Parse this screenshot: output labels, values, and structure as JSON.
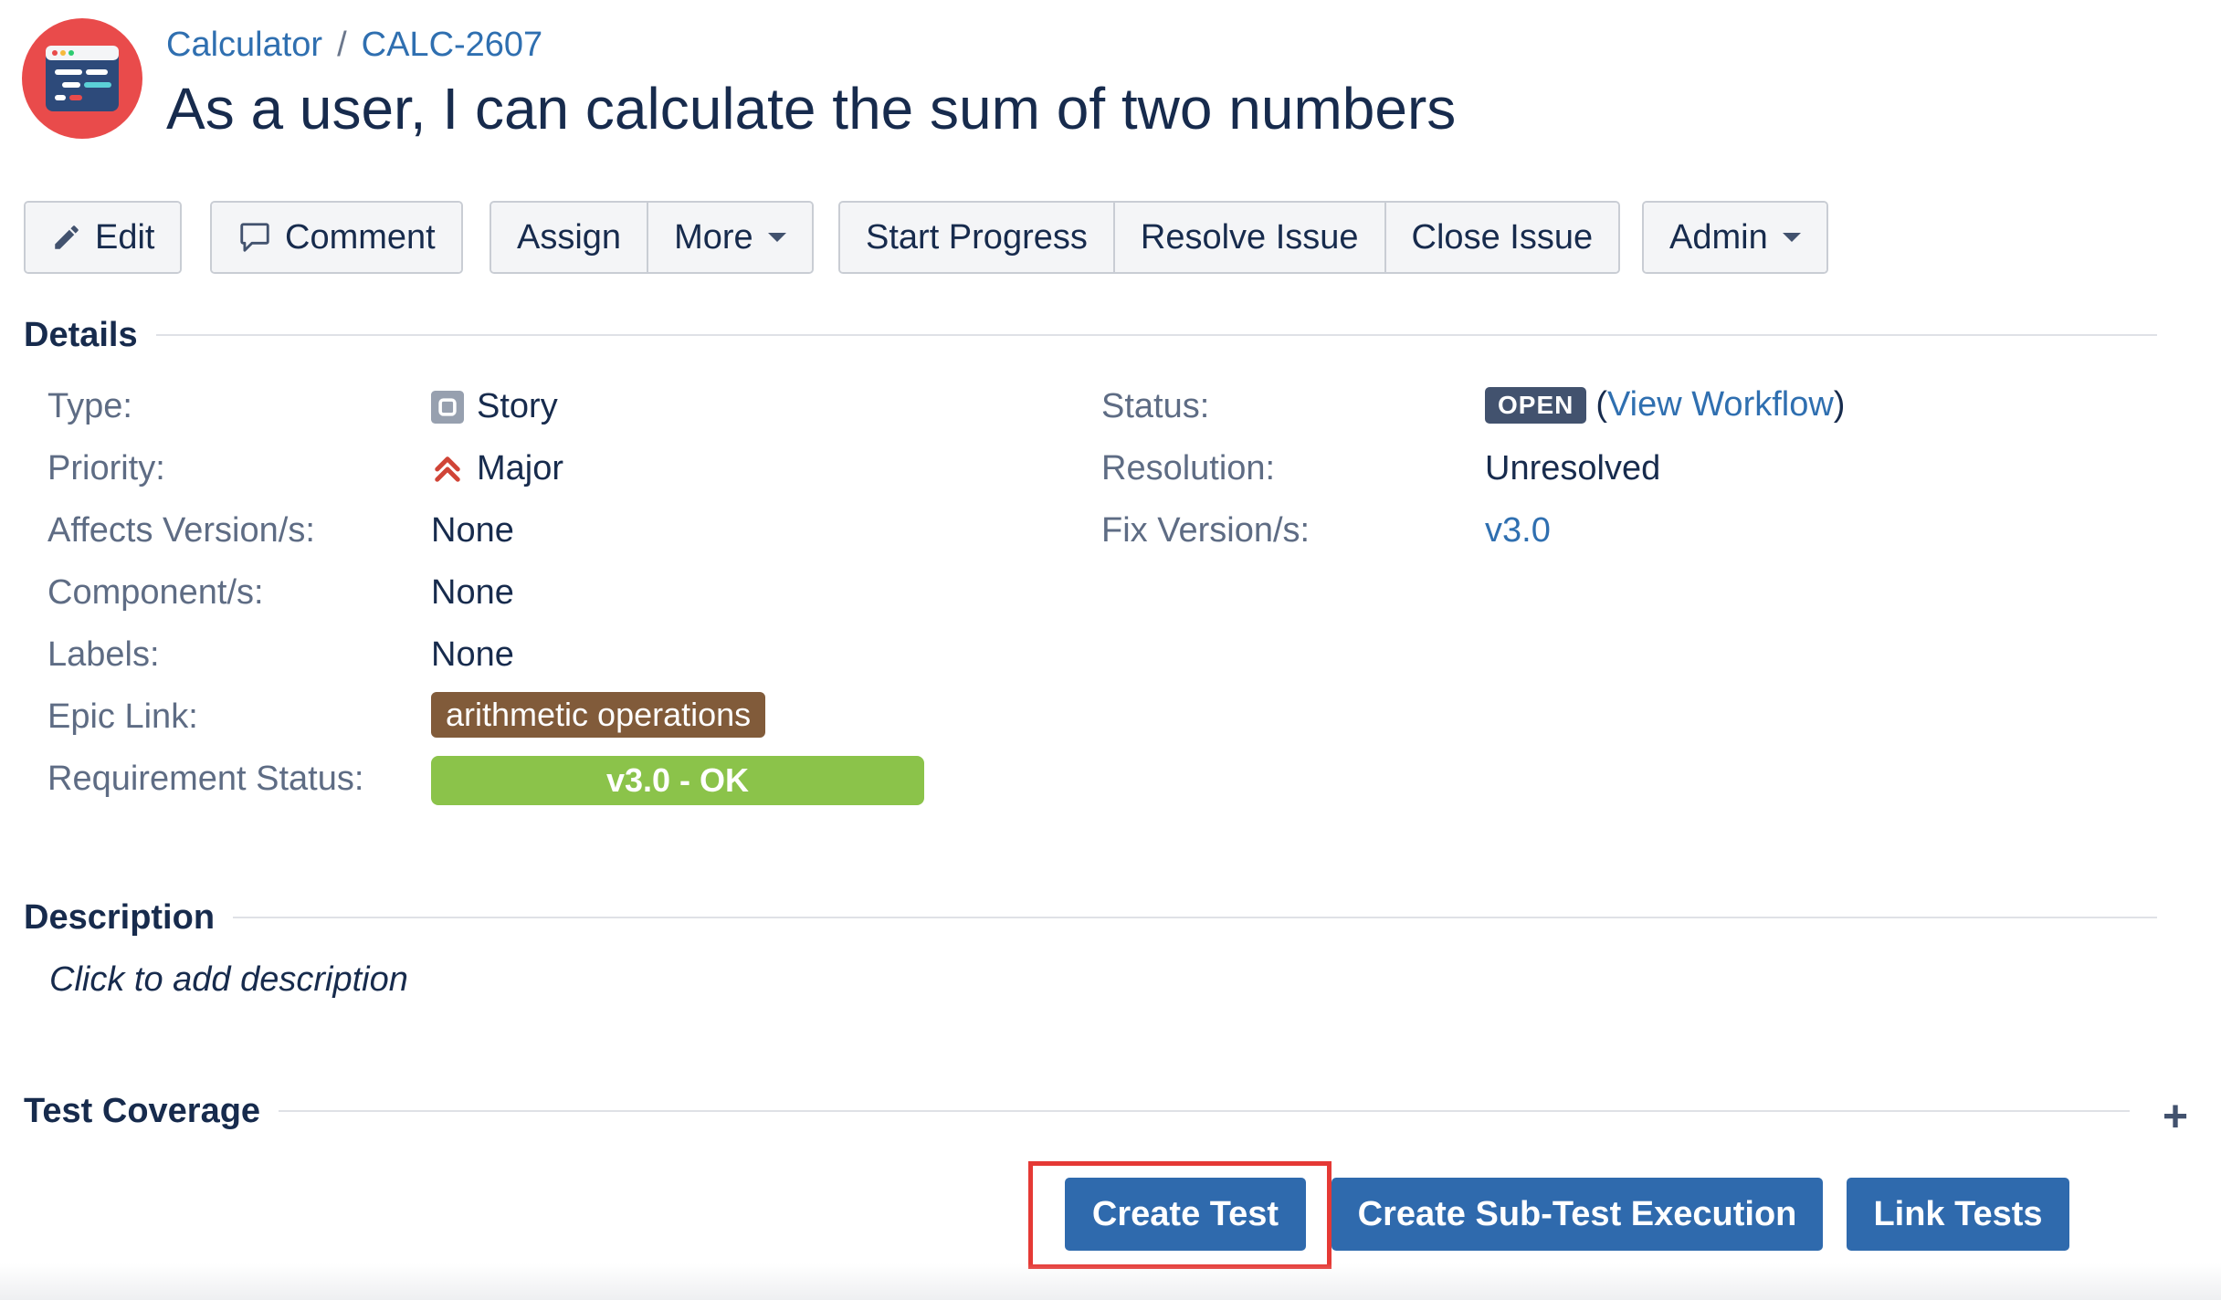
{
  "header": {
    "project": "Calculator",
    "separator": "/",
    "issue_key": "CALC-2607",
    "title": "As a user, I can calculate the sum of two numbers"
  },
  "toolbar": {
    "edit": "Edit",
    "comment": "Comment",
    "assign": "Assign",
    "more": "More",
    "start_progress": "Start Progress",
    "resolve_issue": "Resolve Issue",
    "close_issue": "Close Issue",
    "admin": "Admin"
  },
  "details": {
    "heading": "Details",
    "left": [
      {
        "label": "Type:",
        "value": "Story",
        "icon": "story-icon"
      },
      {
        "label": "Priority:",
        "value": "Major",
        "icon": "priority-major-icon"
      },
      {
        "label": "Affects Version/s:",
        "value": "None"
      },
      {
        "label": "Component/s:",
        "value": "None"
      },
      {
        "label": "Labels:",
        "value": "None"
      },
      {
        "label": "Epic Link:",
        "value": "arithmetic operations"
      },
      {
        "label": "Requirement Status:",
        "value": "v3.0 - OK"
      }
    ],
    "right": [
      {
        "label": "Status:",
        "value": "OPEN",
        "link_open": "(",
        "link": "View Workflow",
        "link_close": ")"
      },
      {
        "label": "Resolution:",
        "value": "Unresolved"
      },
      {
        "label": "Fix Version/s:",
        "value": "v3.0"
      }
    ]
  },
  "description": {
    "heading": "Description",
    "placeholder": "Click to add description"
  },
  "test_coverage": {
    "heading": "Test Coverage",
    "add_symbol": "+",
    "buttons": {
      "create_test": "Create Test",
      "create_sub_test_execution": "Create Sub-Test Execution",
      "link_tests": "Link Tests"
    }
  },
  "colors": {
    "link": "#2f6fb0",
    "primary_button": "#2f6aad",
    "status_lozenge": "#42526e",
    "epic": "#815b3a",
    "requirement_ok": "#8bc34a",
    "highlight": "#e53935",
    "avatar": "#e94b4b"
  }
}
